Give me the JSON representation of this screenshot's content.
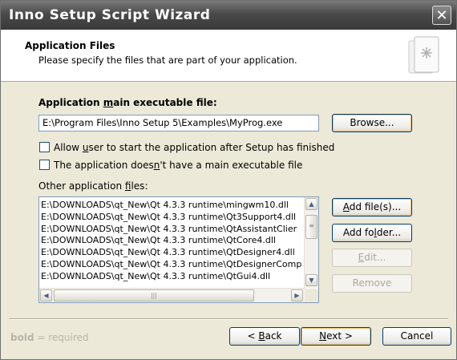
{
  "window": {
    "title": "Inno Setup Script Wizard",
    "close_glyph": "✕"
  },
  "header": {
    "title": "Application Files",
    "subtitle": "Please specify the files that are part of your application."
  },
  "main_exe": {
    "label_pre": "Application ",
    "label_mnemonic": "m",
    "label_post": "ain executable file:",
    "value": "E:\\Program Files\\Inno Setup 5\\Examples\\MyProg.exe",
    "browse_label": "Browse..."
  },
  "options": {
    "allow_start": {
      "checked": false,
      "label_pre": "Allow ",
      "label_mnemonic": "u",
      "label_post": "ser to start the application after Setup has finished"
    },
    "no_exe": {
      "checked": false,
      "label_pre": "The application does",
      "label_mnemonic": "n",
      "label_post": "'t have a main executable file"
    }
  },
  "other_files": {
    "label_pre": "Other application ",
    "label_mnemonic": "f",
    "label_post": "iles:",
    "files": [
      "E:\\DOWNLOADS\\qt_New\\Qt 4.3.3 runtime\\mingwm10.dll",
      "E:\\DOWNLOADS\\qt_New\\Qt 4.3.3 runtime\\Qt3Support4.dll",
      "E:\\DOWNLOADS\\qt_New\\Qt 4.3.3 runtime\\QtAssistantClier",
      "E:\\DOWNLOADS\\qt_New\\Qt 4.3.3 runtime\\QtCore4.dll",
      "E:\\DOWNLOADS\\qt_New\\Qt 4.3.3 runtime\\QtDesigner4.dll",
      "E:\\DOWNLOADS\\qt_New\\Qt 4.3.3 runtime\\QtDesignerComp",
      "E:\\DOWNLOADS\\qt_New\\Qt 4.3.3 runtime\\QtGui4.dll"
    ],
    "add_files_pre": "",
    "add_files_mnemonic": "A",
    "add_files_post": "dd file(s)...",
    "add_folder_pre": "Add fo",
    "add_folder_mnemonic": "l",
    "add_folder_post": "der...",
    "edit_pre": "",
    "edit_mnemonic": "E",
    "edit_post": "dit...",
    "remove_label": "Remove",
    "scroll_up": "▲",
    "scroll_down": "▼",
    "scroll_left": "◀",
    "scroll_right": "▶",
    "grip_v": "≡",
    "grip_h": "|||"
  },
  "footer": {
    "required_bold": "bold",
    "required_rest": " = required",
    "back_pre": "< ",
    "back_mnemonic": "B",
    "back_post": "ack",
    "next_pre": "",
    "next_mnemonic": "N",
    "next_post": "ext >",
    "cancel_label": "Cancel"
  }
}
